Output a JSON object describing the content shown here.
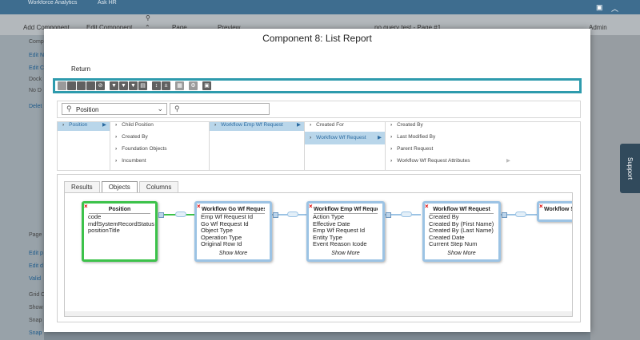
{
  "app": {
    "brand": "Workforce Analytics",
    "ask_hr": "Ask HR",
    "toolbar": {
      "add_component": "Add Component",
      "edit_component": "Edit Component",
      "page": "Page",
      "preview": "Preview",
      "page_name": "no query test - Page #1",
      "admin": "Admin"
    },
    "sidebar": {
      "items": [
        "Comp",
        "Edit N",
        "Edit C",
        "Dock",
        "No D",
        "Delet",
        "Page",
        "Edit p",
        "Edit d",
        "Valid",
        "Grid C",
        "Show",
        "Snap",
        "Snap"
      ]
    },
    "support": "Support"
  },
  "dialog": {
    "title": "Component 8: List Report",
    "return_label": "Return",
    "object_select": {
      "value": "Position",
      "search_placeholder": ""
    },
    "columns": [
      {
        "items": [
          {
            "label": "Position",
            "selected": true
          }
        ]
      },
      {
        "items": [
          {
            "label": "Child Position"
          },
          {
            "label": "Created By"
          },
          {
            "label": "Foundation Objects"
          },
          {
            "label": "Incumbent"
          }
        ]
      },
      {
        "items": [
          {
            "label": "Workflow Emp Wf Request",
            "selected": true
          }
        ]
      },
      {
        "items": [
          {
            "label": "Created For"
          },
          {
            "label": "Workflow Wf Request",
            "selected": true
          }
        ]
      },
      {
        "items": [
          {
            "label": "Created By"
          },
          {
            "label": "Last Modified By"
          },
          {
            "label": "Parent Request"
          },
          {
            "label": "Workflow Wf Request Attributes"
          }
        ]
      }
    ],
    "tabs": [
      {
        "label": "Results",
        "active": false
      },
      {
        "label": "Objects",
        "active": true
      },
      {
        "label": "Columns",
        "active": false
      }
    ],
    "nodes": [
      {
        "title": "Position",
        "fields": [
          "code",
          "mdfSystemRecordStatus",
          "positionTitle"
        ],
        "show_more": ""
      },
      {
        "title": "Workflow Go Wf Request",
        "fields": [
          "Emp Wf Request Id",
          "Go Wf Request Id",
          "Object Type",
          "Operation Type",
          "Original Row Id"
        ],
        "show_more": "Show More"
      },
      {
        "title": "Workflow Emp Wf Request",
        "fields": [
          "Action Type",
          "Effective Date",
          "Emp Wf Request Id",
          "Entity Type",
          "Event Reason Icode"
        ],
        "show_more": "Show More"
      },
      {
        "title": "Workflow Wf Request",
        "fields": [
          "Created By",
          "Created By (First Name)",
          "Created By (Last Name)",
          "Created Date",
          "Current Step Num"
        ],
        "show_more": "Show More"
      },
      {
        "title": "Workflow Ste",
        "fields": [],
        "show_more": ""
      }
    ]
  },
  "colors": {
    "accent_teal": "#2e9bad",
    "node_blue": "#9cc3e4",
    "node_green": "#3cc24a",
    "delete_red": "#d00000"
  }
}
